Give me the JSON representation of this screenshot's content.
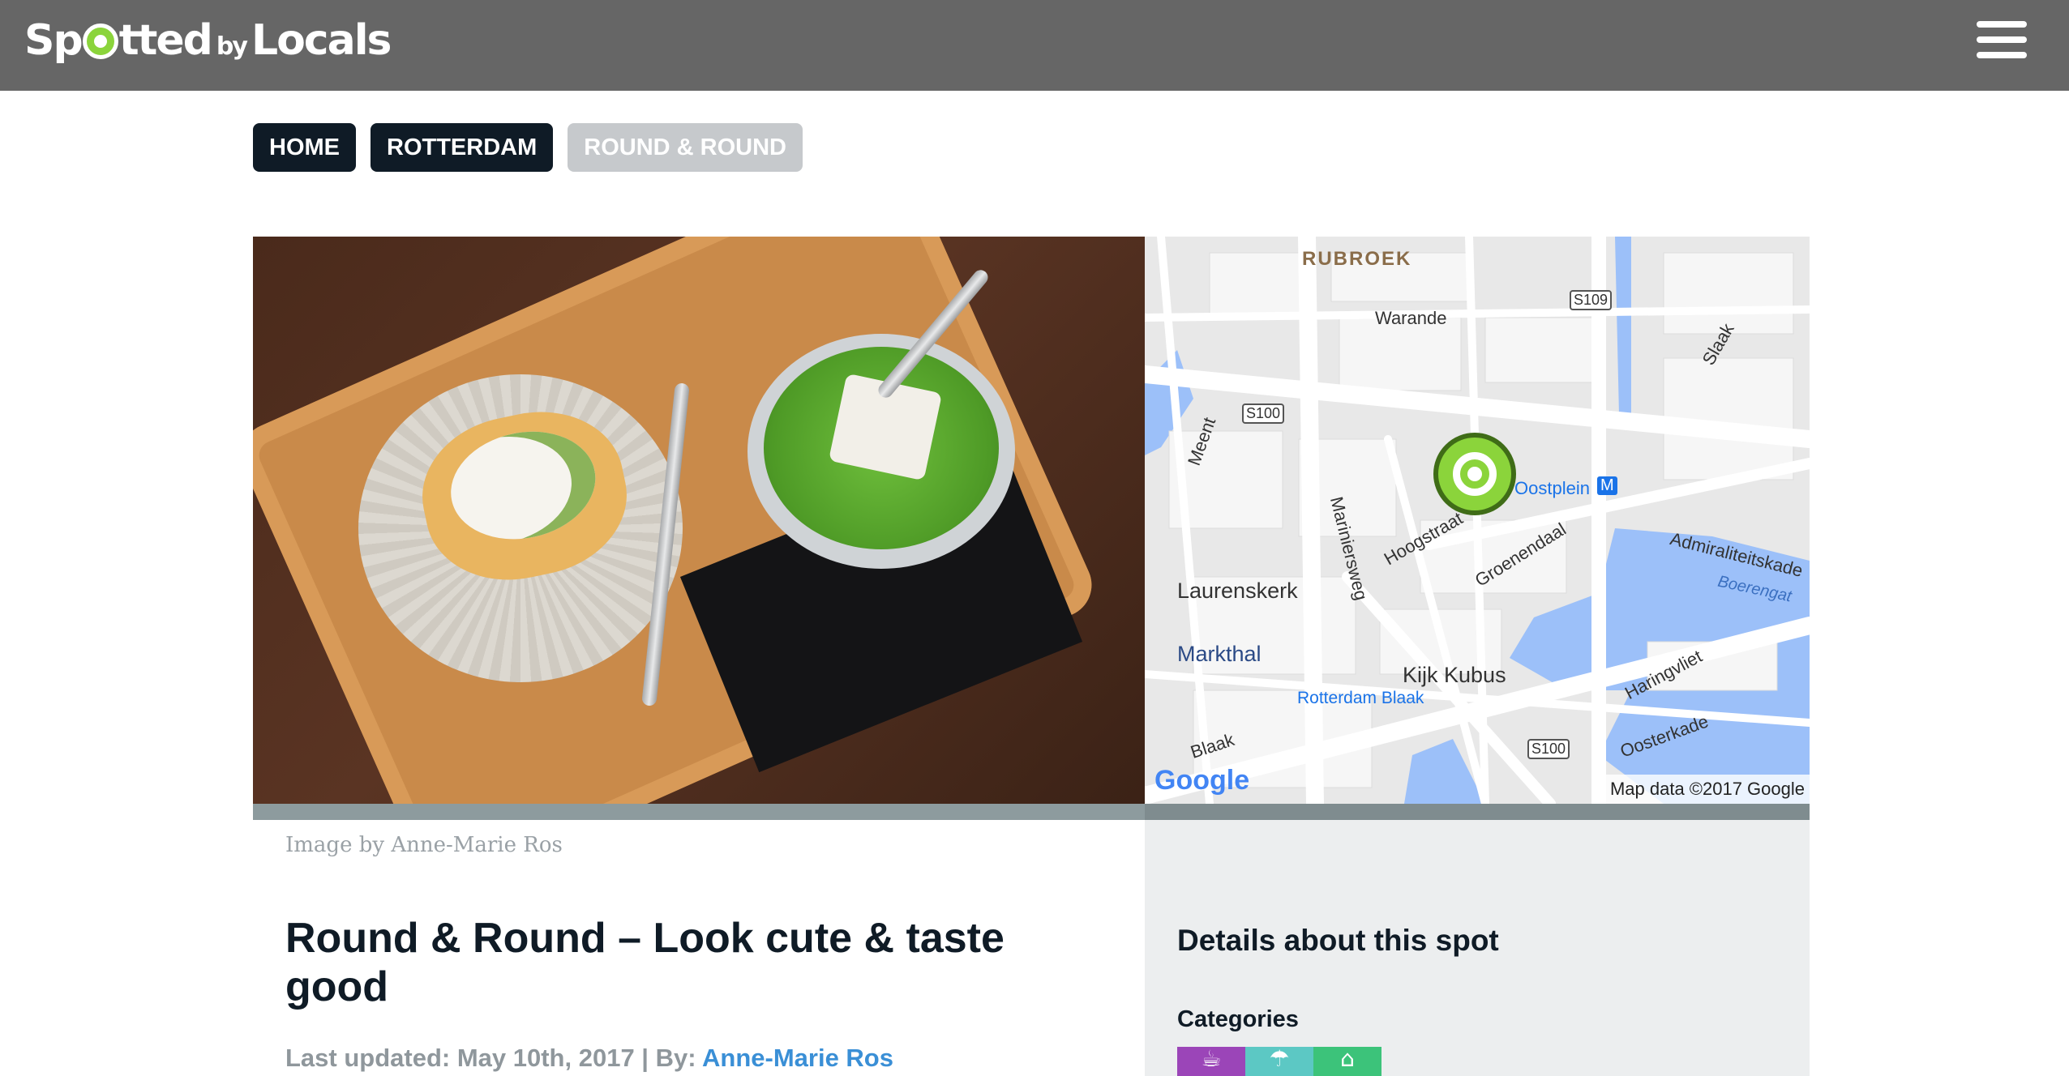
{
  "header": {
    "logo_text_1": "Sp",
    "logo_text_2": "tted",
    "logo_text_by": "by",
    "logo_text_3": "Locals",
    "menu_icon": "hamburger-menu-icon"
  },
  "breadcrumbs": [
    "HOME",
    "ROTTERDAM",
    "ROUND & ROUND"
  ],
  "hero": {
    "image_credit": "Image by Anne-Marie Ros"
  },
  "map": {
    "labels": {
      "rubroek": "RUBROEK",
      "warande": "Warande",
      "s109": "S109",
      "slaak": "Slaak",
      "s100a": "S100",
      "meent": "Meent",
      "oostplein": "Oostplein",
      "m": "M",
      "admiraliteitskade": "Admiraliteitskade",
      "boerengat": "Boerengat",
      "hoogstraat": "Hoogstraat",
      "groenendaal": "Groenendaal",
      "mariniersweg": "Mariniersweg",
      "laurenskerk": "Laurenskerk",
      "markthal": "Markthal",
      "kijk_kubus": "Kijk Kubus",
      "rotterdam_blaak": "Rotterdam Blaak",
      "haringvliet": "Haringvliet",
      "blaak": "Blaak",
      "s100b": "S100",
      "oosterkade": "Oosterkade"
    },
    "google": "Google",
    "attribution": "Map data ©2017 Google"
  },
  "article": {
    "title": "Round & Round – Look cute & taste good",
    "updated_prefix": "Last updated: May 10th, 2017 | By: ",
    "author": "Anne-Marie Ros"
  },
  "sidebar": {
    "title": "Details about this spot",
    "categories_label": "Categories",
    "categories": [
      {
        "icon": "coffee-icon",
        "glyph": "☕",
        "color": "#9b45b8"
      },
      {
        "icon": "umbrella-icon",
        "glyph": "☂",
        "color": "#5cc8c4"
      },
      {
        "icon": "shop-icon",
        "glyph": "⌂",
        "color": "#3cc37a"
      }
    ]
  }
}
